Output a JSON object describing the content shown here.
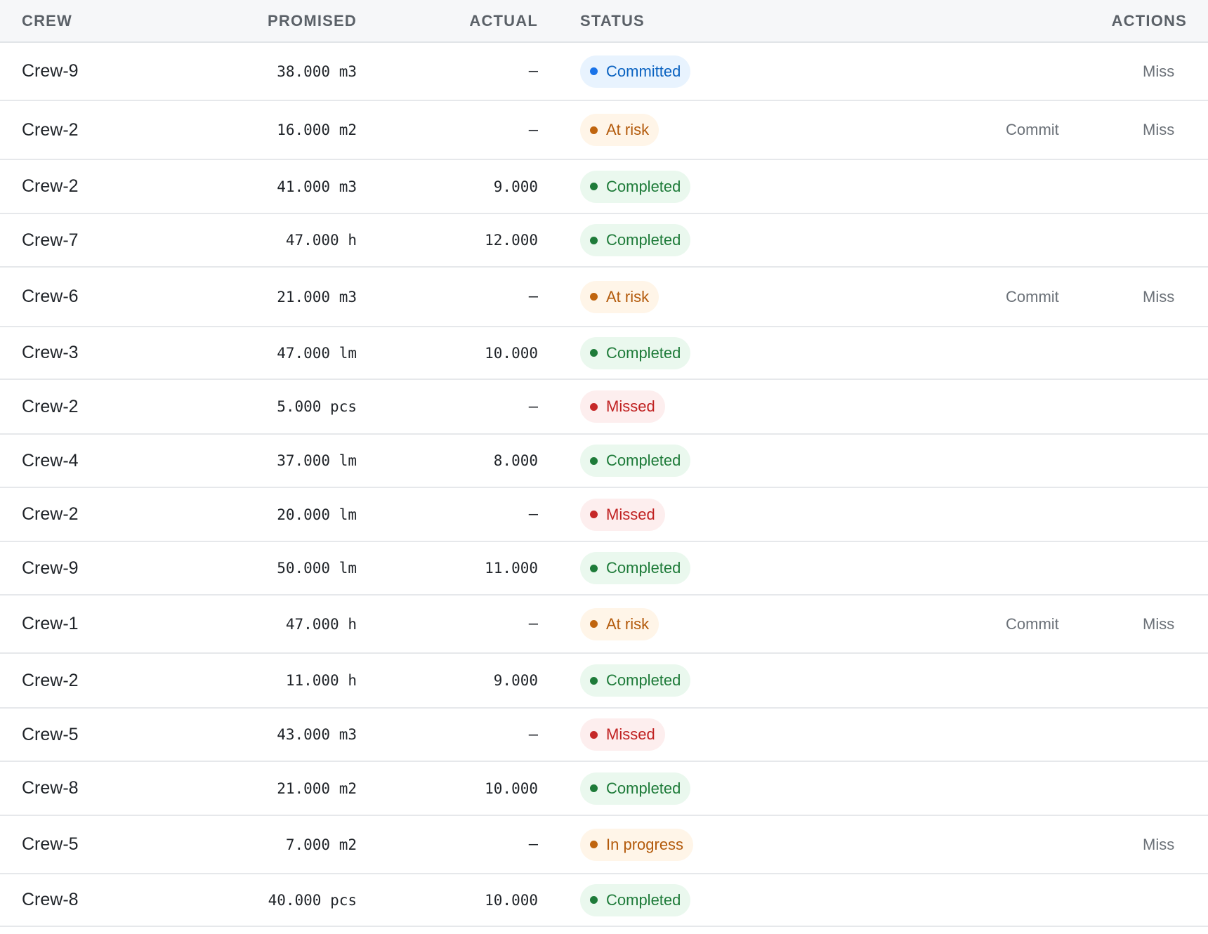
{
  "header": {
    "crew": "CREW",
    "promised": "PROMISED",
    "actual": "ACTUAL",
    "status": "STATUS",
    "actions": "ACTIONS"
  },
  "status_styles": {
    "Committed": {
      "text": "#0b63c1",
      "bg": "#e8f3fe",
      "dot": "#1a73e8"
    },
    "At risk": {
      "text": "#b35a0b",
      "bg": "#fff5e8",
      "dot": "#c0650f"
    },
    "In progress": {
      "text": "#b35a0b",
      "bg": "#fff5e8",
      "dot": "#c0650f"
    },
    "Completed": {
      "text": "#1e7b39",
      "bg": "#eaf8ee",
      "dot": "#1e7b39"
    },
    "Missed": {
      "text": "#c02121",
      "bg": "#fdeeee",
      "dot": "#c62828"
    }
  },
  "rows": [
    {
      "crew": "Crew-9",
      "promised": "38.000 m3",
      "actual": "–",
      "status": "Committed",
      "commit": "",
      "miss": "Miss"
    },
    {
      "crew": "Crew-2",
      "promised": "16.000 m2",
      "actual": "–",
      "status": "At risk",
      "commit": "Commit",
      "miss": "Miss"
    },
    {
      "crew": "Crew-2",
      "promised": "41.000 m3",
      "actual": "9.000",
      "status": "Completed",
      "commit": "",
      "miss": ""
    },
    {
      "crew": "Crew-7",
      "promised": "47.000 h",
      "actual": "12.000",
      "status": "Completed",
      "commit": "",
      "miss": ""
    },
    {
      "crew": "Crew-6",
      "promised": "21.000 m3",
      "actual": "–",
      "status": "At risk",
      "commit": "Commit",
      "miss": "Miss"
    },
    {
      "crew": "Crew-3",
      "promised": "47.000 lm",
      "actual": "10.000",
      "status": "Completed",
      "commit": "",
      "miss": ""
    },
    {
      "crew": "Crew-2",
      "promised": "5.000 pcs",
      "actual": "–",
      "status": "Missed",
      "commit": "",
      "miss": ""
    },
    {
      "crew": "Crew-4",
      "promised": "37.000 lm",
      "actual": "8.000",
      "status": "Completed",
      "commit": "",
      "miss": ""
    },
    {
      "crew": "Crew-2",
      "promised": "20.000 lm",
      "actual": "–",
      "status": "Missed",
      "commit": "",
      "miss": ""
    },
    {
      "crew": "Crew-9",
      "promised": "50.000 lm",
      "actual": "11.000",
      "status": "Completed",
      "commit": "",
      "miss": ""
    },
    {
      "crew": "Crew-1",
      "promised": "47.000 h",
      "actual": "–",
      "status": "At risk",
      "commit": "Commit",
      "miss": "Miss"
    },
    {
      "crew": "Crew-2",
      "promised": "11.000 h",
      "actual": "9.000",
      "status": "Completed",
      "commit": "",
      "miss": ""
    },
    {
      "crew": "Crew-5",
      "promised": "43.000 m3",
      "actual": "–",
      "status": "Missed",
      "commit": "",
      "miss": ""
    },
    {
      "crew": "Crew-8",
      "promised": "21.000 m2",
      "actual": "10.000",
      "status": "Completed",
      "commit": "",
      "miss": ""
    },
    {
      "crew": "Crew-5",
      "promised": "7.000 m2",
      "actual": "–",
      "status": "In progress",
      "commit": "",
      "miss": "Miss"
    },
    {
      "crew": "Crew-8",
      "promised": "40.000 pcs",
      "actual": "10.000",
      "status": "Completed",
      "commit": "",
      "miss": ""
    }
  ]
}
